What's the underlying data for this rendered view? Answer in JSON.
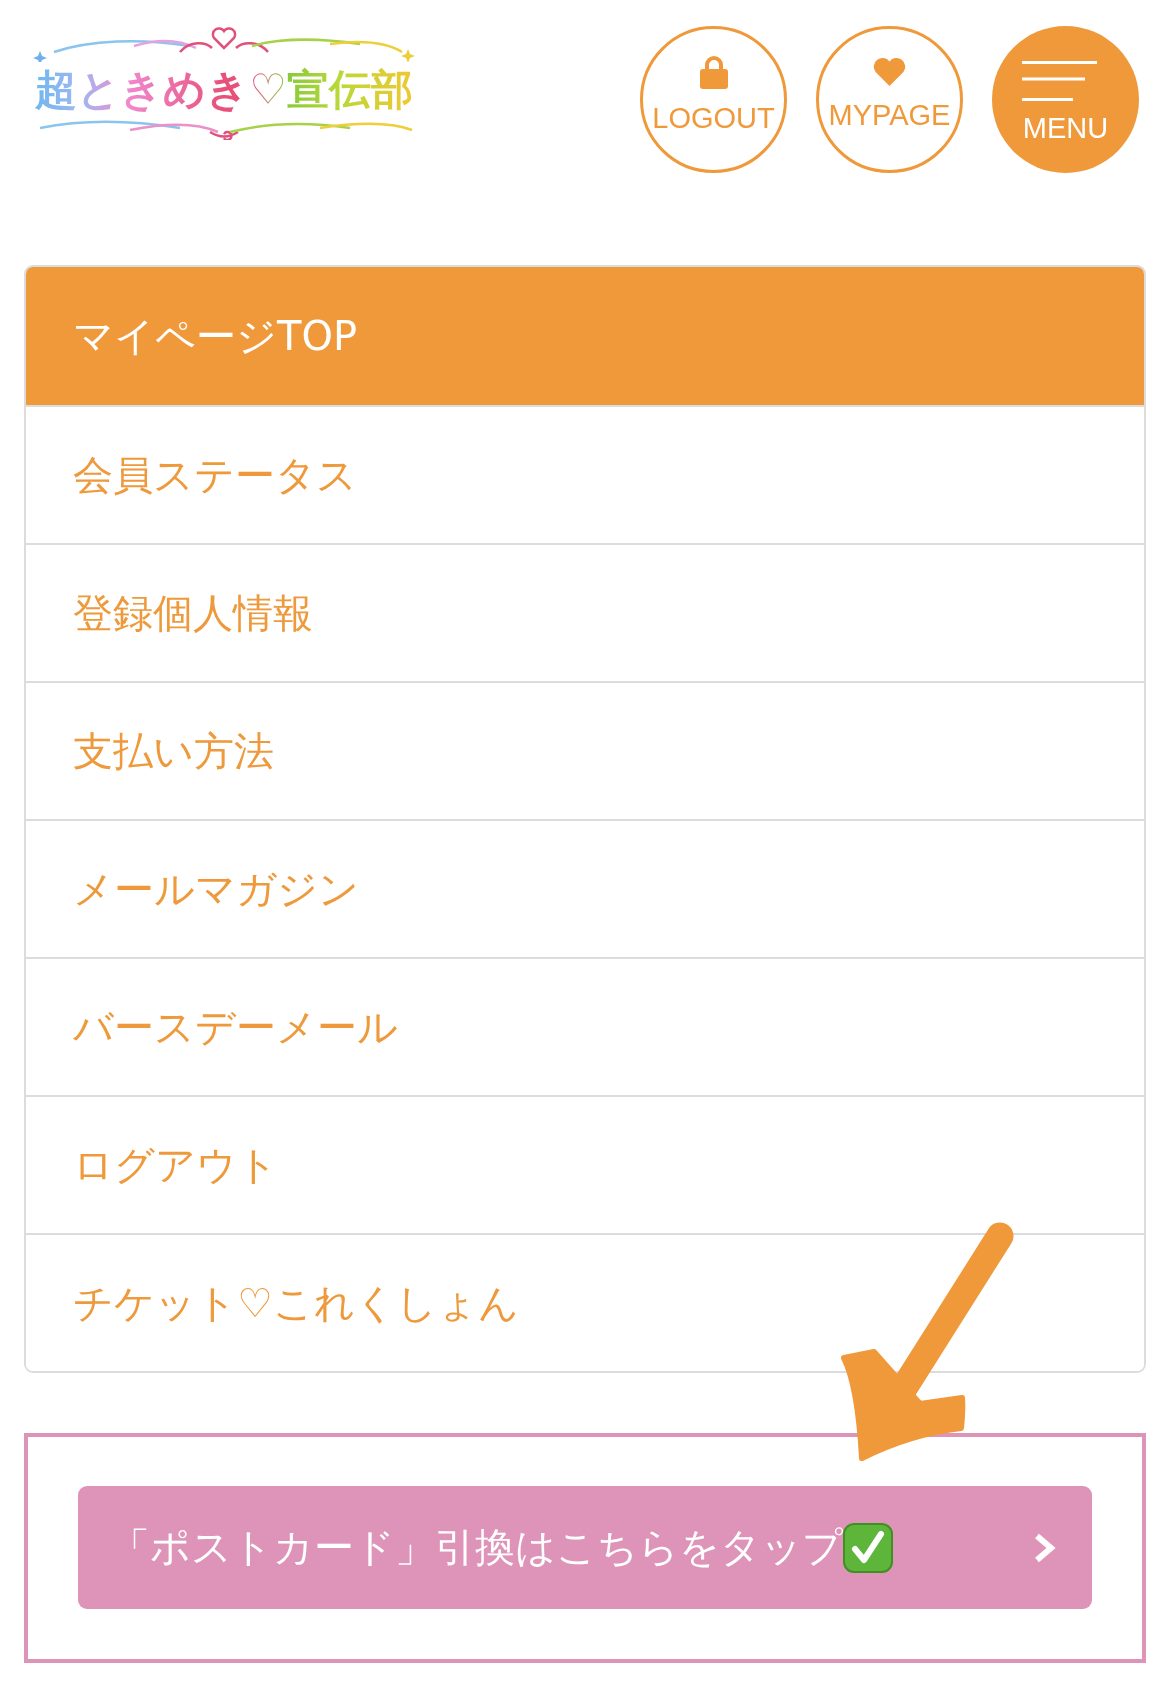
{
  "header": {
    "logo": {
      "text": "超ときめき♡宣伝部"
    },
    "buttons": [
      {
        "kind": "logout",
        "label": "LOGOUT"
      },
      {
        "kind": "mypage",
        "label": "MYPAGE"
      },
      {
        "kind": "menu",
        "label": "MENU"
      }
    ]
  },
  "mypage_menu": {
    "items": [
      {
        "label": "マイページTOP",
        "selected": true
      },
      {
        "label": "会員ステータス",
        "selected": false
      },
      {
        "label": "登録個人情報",
        "selected": false
      },
      {
        "label": "支払い方法",
        "selected": false
      },
      {
        "label": "メールマガジン",
        "selected": false
      },
      {
        "label": "バースデーメール",
        "selected": false
      },
      {
        "label": "ログアウト",
        "selected": false
      },
      {
        "label": "チケット♡これくしょん",
        "selected": false
      }
    ]
  },
  "postcard_banner": {
    "button": {
      "label": "「ポストカード」引換はこちらをタップ"
    }
  }
}
